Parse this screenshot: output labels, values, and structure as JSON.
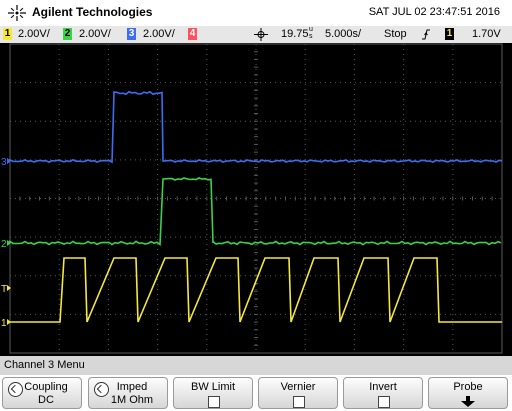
{
  "header": {
    "brand": "Agilent Technologies",
    "datetime": "SAT JUL 02 23:47:51 2016"
  },
  "status": {
    "channels": [
      {
        "num": "1",
        "scale": "2.00V/",
        "color": "#f5e83b"
      },
      {
        "num": "2",
        "scale": "2.00V/",
        "color": "#38d24b"
      },
      {
        "num": "3",
        "scale": "2.00V/",
        "color": "#3b6ef0"
      },
      {
        "num": "4",
        "scale": "",
        "color": "#ff5060"
      }
    ],
    "delay": "19.75",
    "delay_unit_top": "u",
    "delay_unit_bottom": "s",
    "timebase": "5.000",
    "timebase_unit": "s/",
    "run_state": "Stop",
    "trigger_channel": "1",
    "trigger_level": "1.70V"
  },
  "markers": {
    "ch3": "3",
    "ch2": "2",
    "ch1": "1",
    "trigger": "T"
  },
  "menu": {
    "title": "Channel 3  Menu"
  },
  "softkeys": [
    {
      "l1": "Coupling",
      "l2": "DC",
      "icon": "knob-icon"
    },
    {
      "l1": "Imped",
      "l2": "1M Ohm",
      "icon": "knob-icon"
    },
    {
      "l1": "BW Limit",
      "l2": "",
      "icon": "checkbox-icon"
    },
    {
      "l1": "Vernier",
      "l2": "",
      "icon": "checkbox-icon"
    },
    {
      "l1": "Invert",
      "l2": "",
      "icon": "checkbox-icon"
    },
    {
      "l1": "Probe",
      "l2": "",
      "icon": "arrow-down-icon"
    }
  ],
  "colors": {
    "ch1": "#f5e83b",
    "ch2": "#38d24b",
    "ch3": "#3b6ef0",
    "grid": "#5a5a5a"
  }
}
